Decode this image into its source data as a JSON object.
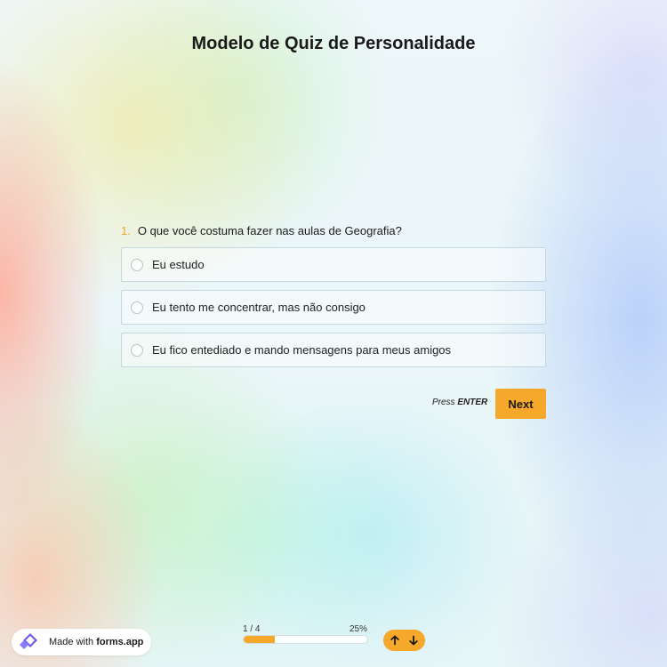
{
  "title": "Modelo de Quiz de Personalidade",
  "question": {
    "number": "1.",
    "text": "O que você costuma fazer nas aulas de Geografia?",
    "options": [
      {
        "label": "Eu estudo"
      },
      {
        "label": "Eu tento me concentrar, mas não consigo"
      },
      {
        "label": "Eu fico entediado e mando mensagens para meus amigos"
      }
    ]
  },
  "actions": {
    "press_label": "Press",
    "enter_label": "ENTER",
    "next_label": "Next"
  },
  "footer": {
    "made_with": "Made with",
    "brand": "forms.app",
    "progress_count": "1 / 4",
    "progress_percent_label": "25%",
    "progress_fraction": 0.25
  },
  "icons": {
    "logo": "forms-app-logo-icon",
    "up": "arrow-up-icon",
    "down": "arrow-down-icon"
  },
  "colors": {
    "accent": "#f6a82a",
    "question_number": "#f2a32a",
    "text": "#1a1a1a"
  }
}
